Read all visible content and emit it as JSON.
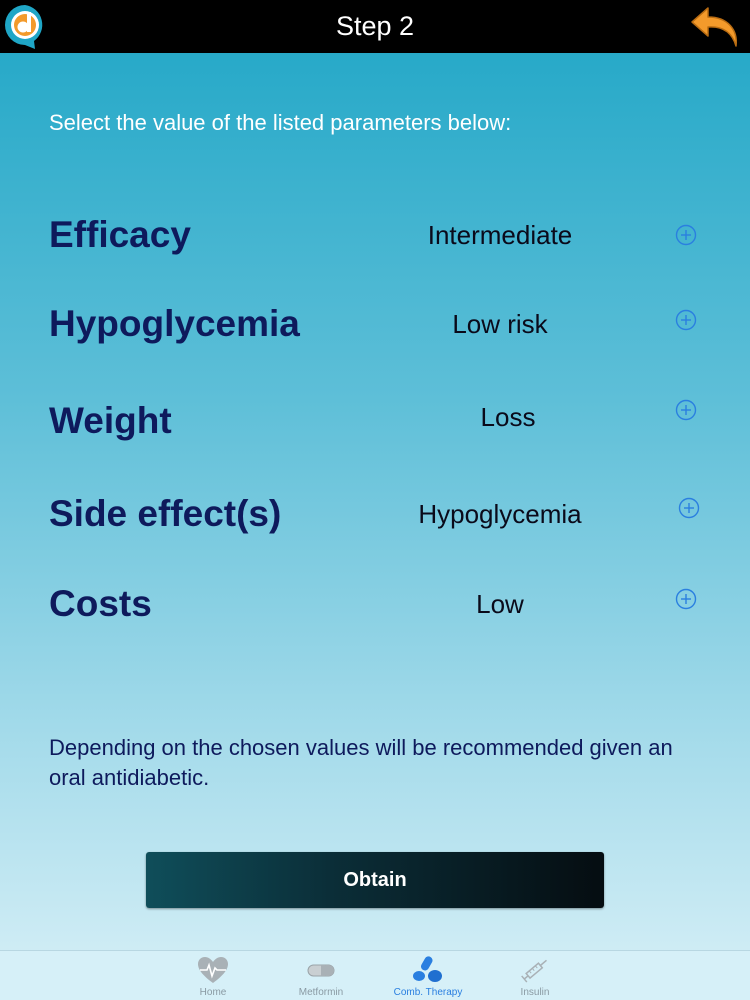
{
  "header": {
    "title": "Step 2"
  },
  "instructions": "Select the value of the listed parameters below:",
  "parameters": [
    {
      "name": "Efficacy",
      "value": "Intermediate"
    },
    {
      "name": "Hypoglycemia",
      "value": "Low risk"
    },
    {
      "name": "Weight",
      "value": "Loss"
    },
    {
      "name": "Side effect(s)",
      "value": "Hypoglycemia"
    },
    {
      "name": "Costs",
      "value": "Low"
    }
  ],
  "note": "Depending on the chosen values will be recommended given an oral antidiabetic.",
  "obtain_label": "Obtain",
  "tabs": [
    {
      "label": "Home",
      "icon": "heart-icon",
      "active": false
    },
    {
      "label": "Metformin",
      "icon": "pill-icon",
      "active": false
    },
    {
      "label": "Comb. Therapy",
      "icon": "combination-pills-icon",
      "active": true
    },
    {
      "label": "Insulin",
      "icon": "syringe-icon",
      "active": false
    }
  ],
  "colors": {
    "header_bg": "#000000",
    "param_name": "#0e1a5c",
    "plus_icon": "#2a7fe0",
    "back_arrow": "#f39a2b",
    "logo_orange": "#f39a2b",
    "logo_teal": "#1fa6c6",
    "tab_active": "#2a7fe0"
  }
}
